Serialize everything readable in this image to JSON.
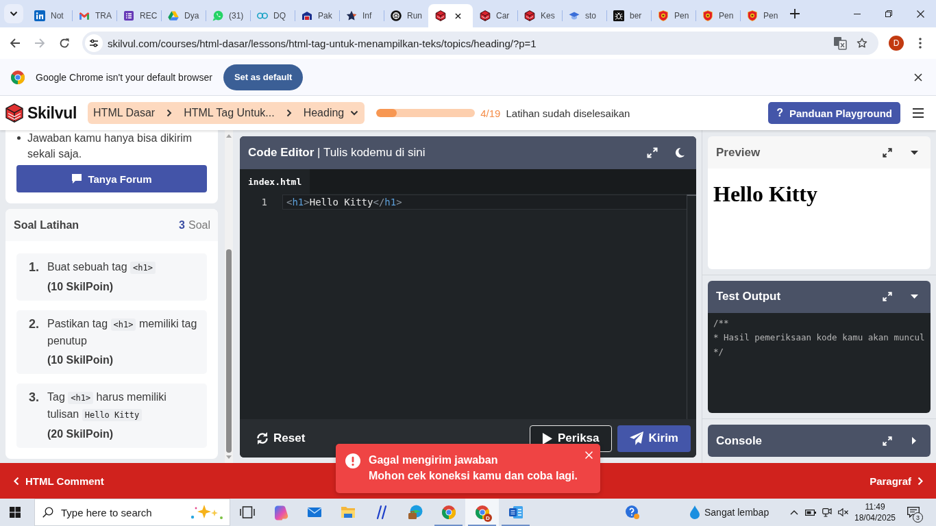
{
  "browser": {
    "tabs": [
      {
        "kind": "tile",
        "label": "Not",
        "selected": false
      },
      {
        "kind": "mail",
        "label": "TRA",
        "selected": false
      },
      {
        "kind": "list",
        "label": "REC",
        "selected": false
      },
      {
        "kind": "triangle",
        "label": "Dya",
        "selected": false
      },
      {
        "kind": "chat",
        "label": "(31)",
        "selected": false
      },
      {
        "kind": "rings",
        "label": "DQ",
        "selected": false
      },
      {
        "kind": "building",
        "label": "Pak",
        "selected": false
      },
      {
        "kind": "star",
        "label": "Inf",
        "selected": false
      },
      {
        "kind": "wheel",
        "label": "Run",
        "selected": false
      },
      {
        "kind": "cube",
        "selected": true
      },
      {
        "kind": "cube",
        "label": "Car",
        "selected": false
      },
      {
        "kind": "cube",
        "label": "Kes",
        "selected": false
      },
      {
        "kind": "cap",
        "label": "sto",
        "selected": false
      },
      {
        "kind": "bug",
        "label": "ber",
        "selected": false
      },
      {
        "kind": "shield",
        "label": "Pen",
        "selected": false
      },
      {
        "kind": "shield",
        "label": "Pen",
        "selected": false
      },
      {
        "kind": "shield",
        "label": "Pen",
        "selected": false
      }
    ],
    "can_go_forward": false,
    "url": "skilvul.com/courses/html-dasar/lessons/html-tag-untuk-menampilkan-teks/topics/heading/?p=1",
    "profile_initial": "D"
  },
  "infobar": {
    "message": "Google Chrome isn't your default browser",
    "button": "Set as default"
  },
  "header": {
    "logo": "Skilvul",
    "breadcrumb": [
      "HTML Dasar",
      "HTML Tag Untuk...",
      "Heading"
    ],
    "progress": {
      "level": 0.21,
      "count": "4/19",
      "label": "Latihan sudah diselesaikan"
    },
    "guide_button": {
      "icon": "?",
      "label": "Panduan Playground"
    }
  },
  "sidebar": {
    "notes": [
      "Jawaban kamu hanya bisa dikirim sekali saja."
    ],
    "forum_button": "Tanya Forum",
    "exercises": {
      "title": "Soal Latihan",
      "count": "3",
      "count_unit": "Soal",
      "items": [
        {
          "number": "1.",
          "parts": [
            {
              "kind": "text",
              "text": "Buat sebuah tag"
            },
            {
              "kind": "code",
              "text": "<h1>"
            }
          ],
          "points": "(10 SkilPoin)"
        },
        {
          "number": "2.",
          "parts": [
            {
              "kind": "text",
              "text": "Pastikan tag"
            },
            {
              "kind": "code",
              "text": "<h1>"
            },
            {
              "kind": "text",
              "text": "memiliki tag penutup"
            }
          ],
          "points": "(10 SkilPoin)"
        },
        {
          "number": "3.",
          "parts": [
            {
              "kind": "text",
              "text": "Tag"
            },
            {
              "kind": "code",
              "text": "<h1>"
            },
            {
              "kind": "text",
              "text": "harus memiliki tulisan"
            },
            {
              "kind": "code",
              "text": "Hello Kitty"
            }
          ],
          "points": "(20 SkilPoin)"
        }
      ]
    }
  },
  "editor": {
    "title": "**Code Editor** | Tulis kodemu di sini",
    "files": [
      {
        "name": "index.html",
        "selected": true
      }
    ],
    "lines": [
      {
        "number": "1",
        "active": true,
        "tokens": [
          {
            "kind": "punct",
            "text": "<"
          },
          {
            "kind": "tag",
            "text": "h1"
          },
          {
            "kind": "punct",
            "text": ">"
          },
          {
            "kind": "text",
            "text": "Hello Kitty"
          },
          {
            "kind": "punct",
            "text": "</"
          },
          {
            "kind": "tag",
            "text": "h1"
          },
          {
            "kind": "punct",
            "text": ">"
          }
        ]
      }
    ],
    "buttons": [
      {
        "kind": "reset",
        "label": "Reset"
      },
      {
        "kind": "check",
        "label": "Periksa"
      },
      {
        "kind": "submit",
        "label": "Kirim"
      }
    ]
  },
  "panels": [
    {
      "kind": "preview",
      "title": "Preview",
      "expanded": true,
      "heading": "Hello Kitty"
    },
    {
      "kind": "output",
      "title": "Test Output",
      "expanded": true,
      "lines": [
        "/**",
        "* Hasil pemeriksaan kode kamu akan muncul",
        "*/"
      ]
    },
    {
      "kind": "console",
      "title": "Console",
      "expanded": false
    }
  ],
  "lesson_nav": {
    "previous": "HTML Comment",
    "next": "Paragraf"
  },
  "toast": {
    "title": "Gagal mengirim jawaban",
    "message": "Mohon cek koneksi kamu dan coba lagi."
  },
  "taskbar": {
    "search_placeholder": "Type here to search",
    "apps": [
      {
        "kind": "task-view",
        "running": false,
        "selected": false
      },
      {
        "kind": "blob",
        "running": false,
        "selected": false
      },
      {
        "kind": "mail",
        "running": false,
        "selected": false
      },
      {
        "kind": "folder",
        "running": false,
        "selected": false
      },
      {
        "kind": "slashes",
        "running": false,
        "selected": false
      },
      {
        "kind": "globe",
        "running": false,
        "selected": false
      },
      {
        "kind": "browser",
        "running": true,
        "selected": false
      },
      {
        "kind": "browser",
        "running": true,
        "selected": true,
        "badge": "D"
      },
      {
        "kind": "document",
        "running": true,
        "selected": false
      }
    ],
    "weather": "Sangat lembap",
    "time": "11:49",
    "date": "18/04/2025",
    "notifications": "3"
  }
}
